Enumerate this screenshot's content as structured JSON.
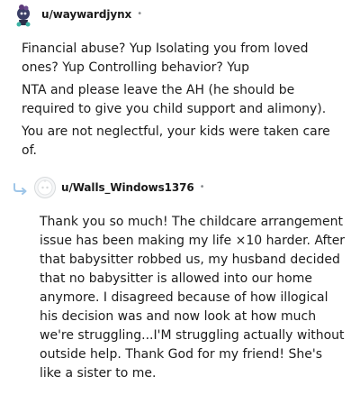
{
  "comment1": {
    "username": "u/waywardjynx",
    "separator": "•",
    "avatar_icon": "snoo-avatar-icon",
    "paragraphs": [
      "Financial abuse? Yup Isolating you from loved ones? Yup Controlling behavior? Yup",
      "NTA and please leave the AH (he should be required to give you child support and alimony).",
      "You are not neglectful, your kids were taken care of."
    ]
  },
  "comment2": {
    "username": "u/Walls_Windows1376",
    "separator": "•",
    "reply_icon": "reply-arrow-icon",
    "avatar_icon": "default-avatar-icon",
    "paragraphs": [
      "Thank you so much! The childcare arrangement issue has been making my life ×10 harder. After that babysitter robbed us, my husband decided that no babysitter is allowed into our home anymore. I disagreed because of how illogical his decision was and now look at how much we're struggling...I'M struggling actually without outside help. Thank God for my friend! She's like a sister to me."
    ]
  },
  "colors": {
    "text": "#1c1c1c",
    "meta": "#878a8c",
    "reply_arrow": "#9fc6e8"
  }
}
